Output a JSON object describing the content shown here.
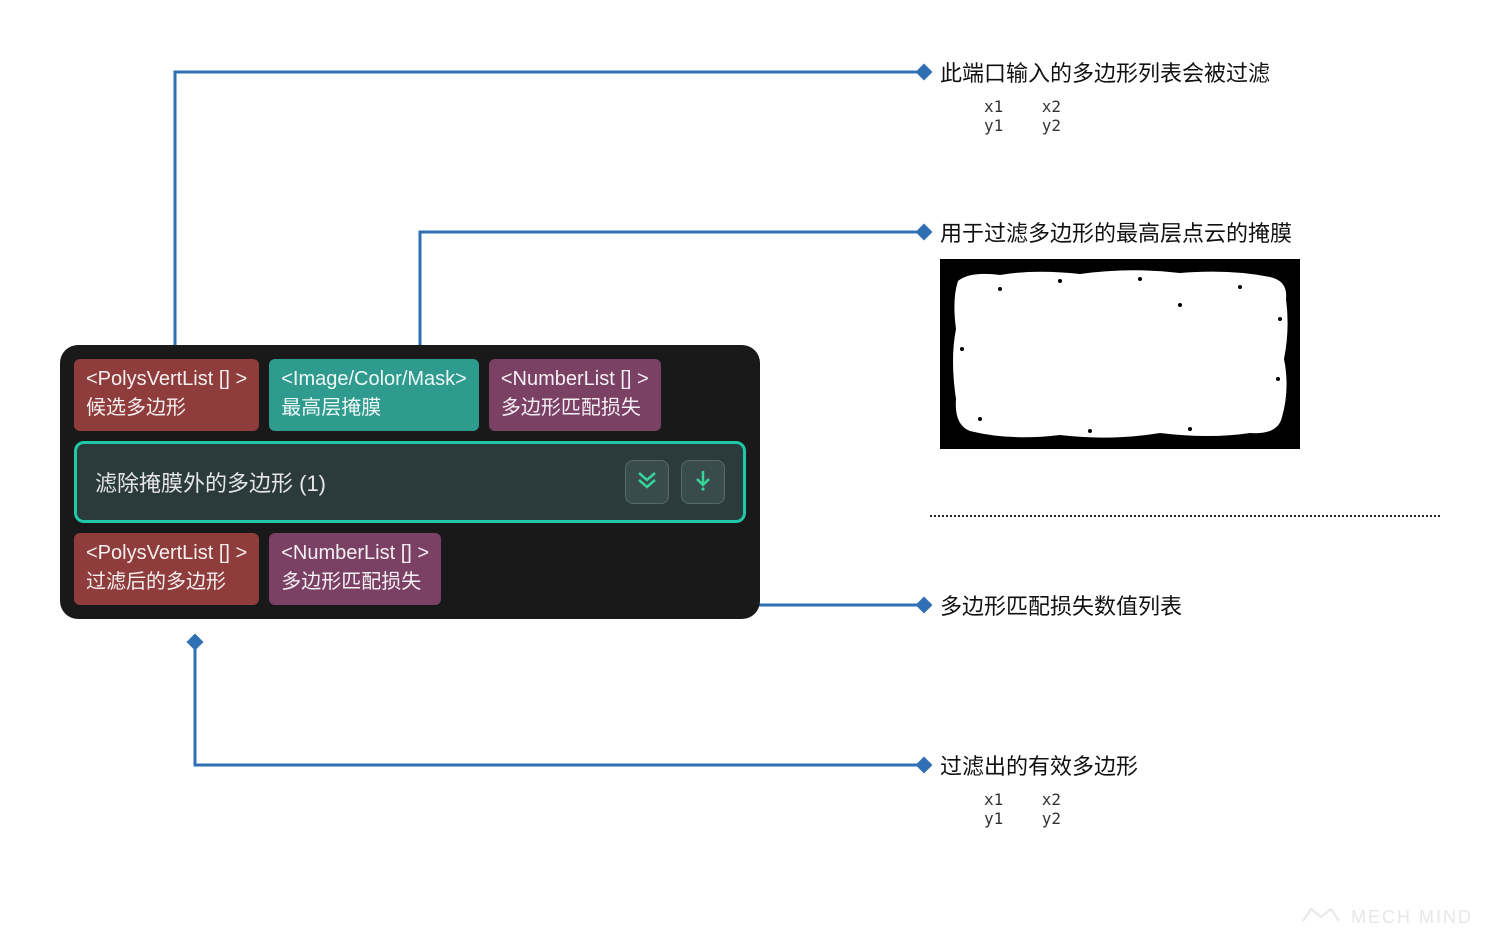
{
  "node": {
    "title": "滤除掩膜外的多边形 (1)",
    "inputs": [
      {
        "type": "<PolysVertList [] >",
        "label": "候选多边形",
        "color": "red"
      },
      {
        "type": "<Image/Color/Mask>",
        "label": "最高层掩膜",
        "color": "teal"
      },
      {
        "type": "<NumberList [] >",
        "label": "多边形匹配损失",
        "color": "plum"
      }
    ],
    "outputs": [
      {
        "type": "<PolysVertList [] >",
        "label": "过滤后的多边形",
        "color": "red"
      },
      {
        "type": "<NumberList [] >",
        "label": "多边形匹配损失",
        "color": "plum"
      }
    ]
  },
  "annotations": {
    "in_polys": {
      "title": "此端口输入的多边形列表会被过滤",
      "coords": "x1    x2\ny1    y2"
    },
    "in_mask": {
      "title": "用于过滤多边形的最高层点云的掩膜"
    },
    "out_loss": {
      "title": "多边形匹配损失数值列表"
    },
    "out_polys": {
      "title": "过滤出的有效多边形",
      "coords": "x1    x2\ny1    y2"
    }
  },
  "watermark": "MECH MIND"
}
